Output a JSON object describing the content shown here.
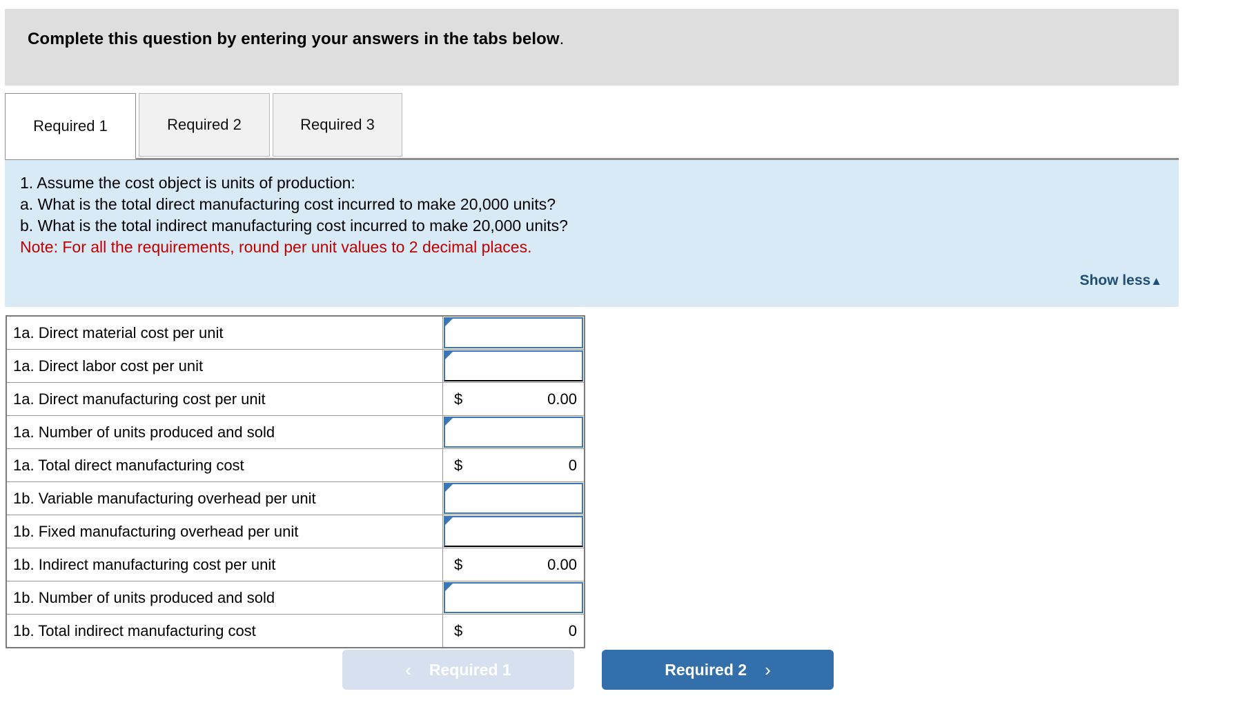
{
  "banner": {
    "text_bold": "Complete this question by entering your answers in the tabs below",
    "text_tail": "."
  },
  "tabs": [
    {
      "label": "Required 1",
      "active": true
    },
    {
      "label": "Required 2",
      "active": false
    },
    {
      "label": "Required 3",
      "active": false
    }
  ],
  "instructions": {
    "line1": "1. Assume the cost object is units of production:",
    "line2": "a. What is the total direct manufacturing cost incurred to make 20,000 units?",
    "line3": "b. What is the total indirect manufacturing cost incurred to make 20,000 units?",
    "note": "Note: For all the requirements, round per unit values to 2 decimal places.",
    "show_less_label": "Show less",
    "show_less_caret": "▲",
    "note_color": "#c00000",
    "panel_color": "#d9eaf7",
    "link_color": "#1f4e79"
  },
  "table": {
    "rows": [
      {
        "label": "1a. Direct material cost per unit",
        "type": "input",
        "value": "",
        "underline": false
      },
      {
        "label": "1a. Direct labor cost per unit",
        "type": "input",
        "value": "",
        "underline": true
      },
      {
        "label": "1a. Direct manufacturing cost per unit",
        "type": "computed",
        "currency": "$",
        "amount": "0.00"
      },
      {
        "label": "1a. Number of units produced and sold",
        "type": "input",
        "value": "",
        "underline": false
      },
      {
        "label": "1a. Total direct manufacturing cost",
        "type": "computed",
        "currency": "$",
        "amount": "0"
      },
      {
        "label": "1b. Variable manufacturing overhead per unit",
        "type": "input",
        "value": "",
        "underline": false
      },
      {
        "label": "1b. Fixed manufacturing overhead per unit",
        "type": "input",
        "value": "",
        "underline": true
      },
      {
        "label": "1b. Indirect manufacturing cost per unit",
        "type": "computed",
        "currency": "$",
        "amount": "0.00"
      },
      {
        "label": "1b. Number of units produced and sold",
        "type": "input",
        "value": "",
        "underline": false
      },
      {
        "label": "1b. Total indirect manufacturing cost",
        "type": "computed",
        "currency": "$",
        "amount": "0"
      }
    ]
  },
  "footer": {
    "prev_label": "Required 1",
    "prev_chevron": "‹",
    "prev_disabled": true,
    "next_label": "Required 2",
    "next_chevron": "›",
    "prev_color": "#d6e0ef",
    "next_color": "#336fab"
  }
}
